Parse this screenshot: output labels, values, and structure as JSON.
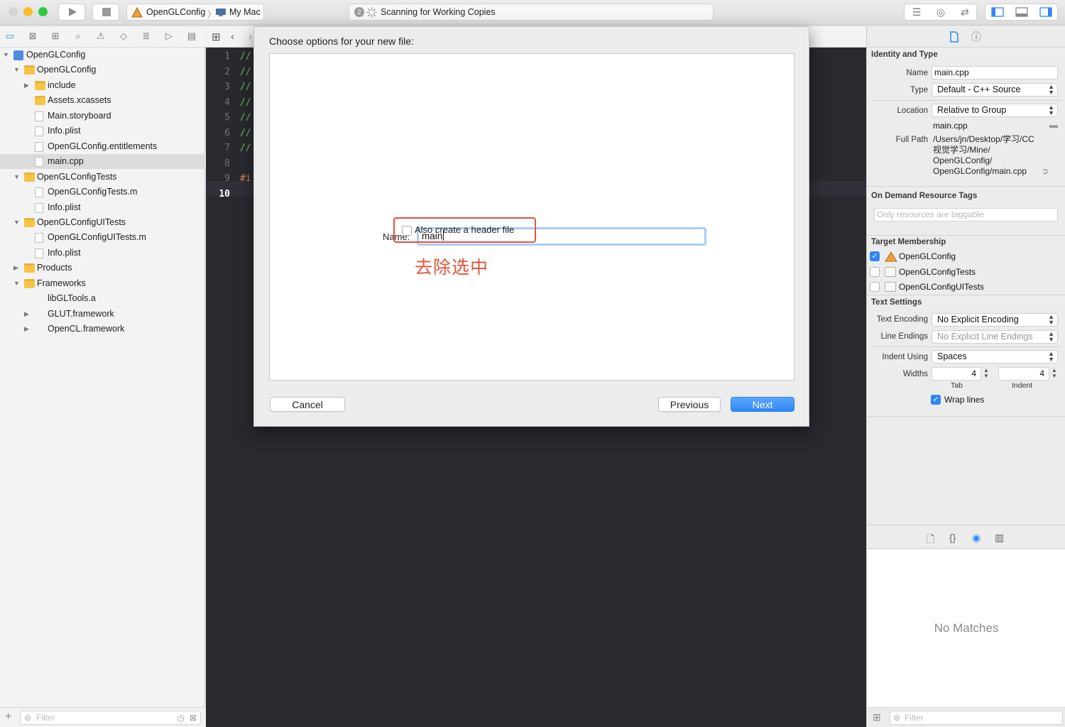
{
  "toolbar": {
    "scheme_project": "OpenGLConfig",
    "scheme_destination": "My Mac",
    "activity_badge": "2",
    "activity_status": "Scanning for Working Copies"
  },
  "navigator": {
    "items": [
      {
        "label": "OpenGLConfig",
        "level": 0,
        "kind": "project",
        "disclosure": "▼"
      },
      {
        "label": "OpenGLConfig",
        "level": 1,
        "kind": "folder",
        "disclosure": "▼"
      },
      {
        "label": "include",
        "level": 2,
        "kind": "folder",
        "disclosure": "▶"
      },
      {
        "label": "Assets.xcassets",
        "level": 2,
        "kind": "assets",
        "disclosure": ""
      },
      {
        "label": "Main.storyboard",
        "level": 2,
        "kind": "storyboard",
        "disclosure": ""
      },
      {
        "label": "Info.plist",
        "level": 2,
        "kind": "doc",
        "disclosure": ""
      },
      {
        "label": "OpenGLConfig.entitlements",
        "level": 2,
        "kind": "doc",
        "disclosure": ""
      },
      {
        "label": "main.cpp",
        "level": 2,
        "kind": "cpp",
        "disclosure": "",
        "selected": true
      },
      {
        "label": "OpenGLConfigTests",
        "level": 1,
        "kind": "folder",
        "disclosure": "▼"
      },
      {
        "label": "OpenGLConfigTests.m",
        "level": 2,
        "kind": "m",
        "disclosure": ""
      },
      {
        "label": "Info.plist",
        "level": 2,
        "kind": "doc",
        "disclosure": ""
      },
      {
        "label": "OpenGLConfigUITests",
        "level": 1,
        "kind": "folder",
        "disclosure": "▼"
      },
      {
        "label": "OpenGLConfigUITests.m",
        "level": 2,
        "kind": "m",
        "disclosure": ""
      },
      {
        "label": "Info.plist",
        "level": 2,
        "kind": "doc",
        "disclosure": ""
      },
      {
        "label": "Products",
        "level": 1,
        "kind": "folder",
        "disclosure": "▶"
      },
      {
        "label": "Frameworks",
        "level": 1,
        "kind": "folder",
        "disclosure": "▼"
      },
      {
        "label": "libGLTools.a",
        "level": 2,
        "kind": "lib",
        "disclosure": ""
      },
      {
        "label": "GLUT.framework",
        "level": 2,
        "kind": "framework",
        "disclosure": "▶"
      },
      {
        "label": "OpenCL.framework",
        "level": 2,
        "kind": "framework",
        "disclosure": "▶"
      }
    ],
    "filter_placeholder": "Filter"
  },
  "editor": {
    "line_numbers": [
      "1",
      "2",
      "3",
      "4",
      "5",
      "6",
      "7",
      "8",
      "9",
      "10"
    ],
    "current_line": "10",
    "code": [
      "//",
      "//",
      "//",
      "//",
      "//",
      "//",
      "//",
      "",
      "#i",
      ""
    ]
  },
  "dialog": {
    "title": "Choose options for your new file:",
    "name_label": "Name:",
    "name_value": "main",
    "checkbox_label": "Also create a header file",
    "checkbox_checked": false,
    "annotation": "去除选中",
    "cancel_label": "Cancel",
    "previous_label": "Previous",
    "next_label": "Next"
  },
  "inspector": {
    "identity": {
      "heading": "Identity and Type",
      "name_label": "Name",
      "name_value": "main.cpp",
      "type_label": "Type",
      "type_value": "Default - C++ Source",
      "location_label": "Location",
      "location_value": "Relative to Group",
      "location_file": "main.cpp",
      "full_path_label": "Full Path",
      "full_path_lines": [
        "/Users/jn/Desktop/学习/CC",
        "视觉学习/Mine/",
        "OpenGLConfig/",
        "OpenGLConfig/main.cpp"
      ]
    },
    "on_demand": {
      "heading": "On Demand Resource Tags",
      "placeholder": "Only resources are taggable"
    },
    "target_membership": {
      "heading": "Target Membership",
      "targets": [
        {
          "label": "OpenGLConfig",
          "checked": true
        },
        {
          "label": "OpenGLConfigTests",
          "checked": false
        },
        {
          "label": "OpenGLConfigUITests",
          "checked": false
        }
      ]
    },
    "text_settings": {
      "heading": "Text Settings",
      "encoding_label": "Text Encoding",
      "encoding_value": "No Explicit Encoding",
      "line_endings_label": "Line Endings",
      "line_endings_value": "No Explicit Line Endings",
      "indent_using_label": "Indent Using",
      "indent_using_value": "Spaces",
      "widths_label": "Widths",
      "tab_value": "4",
      "indent_value": "4",
      "tab_caption": "Tab",
      "indent_caption": "Indent",
      "wrap_label": "Wrap lines",
      "wrap_checked": true
    },
    "library": {
      "empty_text": "No Matches",
      "filter_placeholder": "Filter"
    }
  },
  "colors": {
    "accent": "#2f86f6",
    "annotation_red": "#e2533a",
    "editor_bg": "#292a30",
    "comment_green": "#6bbf59",
    "preprocessor_orange": "#c98c4e"
  }
}
